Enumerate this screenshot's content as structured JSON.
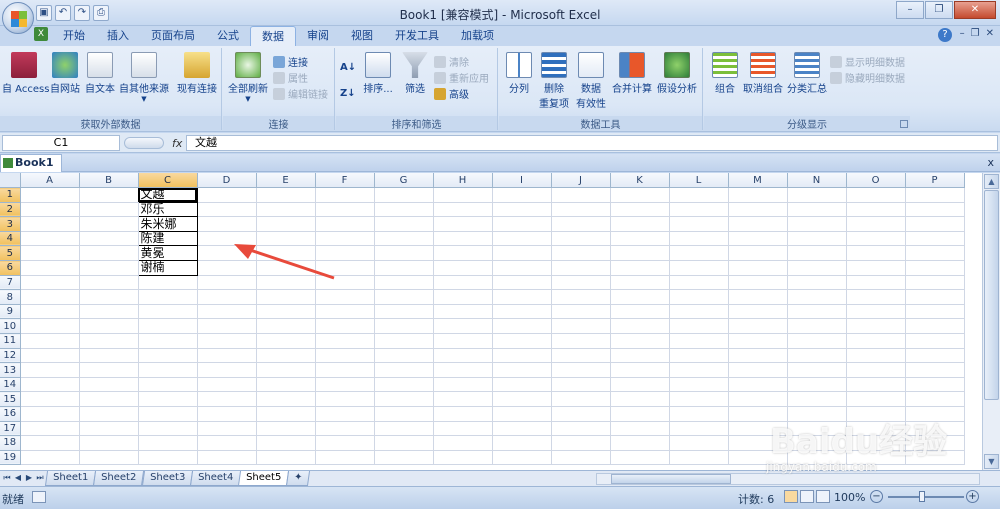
{
  "window": {
    "title": "Book1  [兼容模式] - Microsoft Excel"
  },
  "colors": {
    "accent": "#c5d7ef",
    "selected_header": "#f1c15f",
    "arrow": "#e84a3b",
    "excel_green": "#3f8a3a"
  },
  "quick_access": {
    "icons": [
      "save-icon",
      "undo-icon",
      "redo-icon",
      "print-preview-icon"
    ]
  },
  "ribbon_tabs": [
    "开始",
    "插入",
    "页面布局",
    "公式",
    "数据",
    "审阅",
    "视图",
    "开发工具",
    "加载项"
  ],
  "active_tab": "数据",
  "groups": {
    "external": {
      "label": "获取外部数据",
      "buttons": [
        "自 Access",
        "自网站",
        "自文本",
        "自其他来源",
        "现有连接"
      ]
    },
    "connections": {
      "label": "连接",
      "refresh": "全部刷新",
      "small": [
        "连接",
        "属性",
        "编辑链接"
      ]
    },
    "sortfilter": {
      "label": "排序和筛选",
      "sort": "排序...",
      "filter": "筛选",
      "small": [
        "清除",
        "重新应用",
        "高级"
      ]
    },
    "datatools": {
      "label": "数据工具",
      "buttons": [
        "分列",
        "删除\n重复项",
        "数据\n有效性",
        "合并计算",
        "假设分析"
      ],
      "b1": "分列",
      "b2a": "删除",
      "b2b": "重复项",
      "b3a": "数据",
      "b3b": "有效性",
      "b4": "合并计算",
      "b5": "假设分析"
    },
    "outline": {
      "label": "分级显示",
      "buttons": [
        "组合",
        "取消组合",
        "分类汇总"
      ],
      "small": [
        "显示明细数据",
        "隐藏明细数据"
      ]
    }
  },
  "formula_bar": {
    "name_box": "C1",
    "fx": "fx",
    "content": "文越"
  },
  "workbook": {
    "tab": "Book1 *",
    "close": "x"
  },
  "sheet": {
    "columns": [
      "A",
      "B",
      "C",
      "D",
      "E",
      "F",
      "G",
      "H",
      "I",
      "J",
      "K",
      "L",
      "M",
      "N",
      "O",
      "P"
    ],
    "rows": [
      "1",
      "2",
      "3",
      "4",
      "5",
      "6",
      "7",
      "8",
      "9",
      "10",
      "11",
      "12",
      "13",
      "14",
      "15",
      "16",
      "17",
      "18",
      "19"
    ],
    "c_values": [
      "文越",
      "邓乐",
      "朱米娜",
      "陈建",
      "黄冕",
      "谢楠"
    ]
  },
  "sheet_tabs": [
    "Sheet1",
    "Sheet2",
    "Sheet3",
    "Sheet4",
    "Sheet5"
  ],
  "active_sheet": "Sheet5",
  "status": {
    "ready": "就绪",
    "count": "计数: 6",
    "zoom": "100%"
  },
  "watermark": {
    "brand": "Baidu经验",
    "url": "jingyan.baidu.com"
  }
}
